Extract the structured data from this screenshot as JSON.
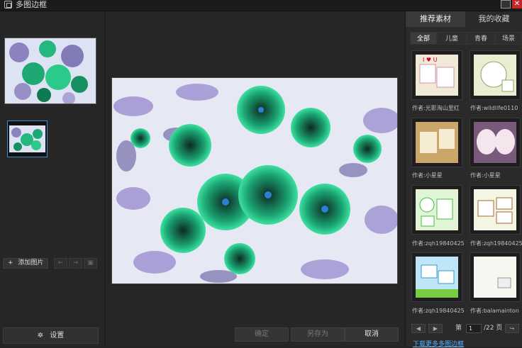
{
  "window": {
    "title": "多图边框",
    "close_glyph": "✕"
  },
  "left": {
    "add_photo_label": "添加图片",
    "add_icon": "+",
    "prev_glyph": "←",
    "next_glyph": "→",
    "delete_glyph": "▣",
    "settings_label": "设置",
    "settings_icon": "✲"
  },
  "center": {
    "confirm_label": "确定",
    "save_as_label": "另存为",
    "cancel_label": "取消"
  },
  "right": {
    "tabs": [
      {
        "label": "推荐素材",
        "active": true
      },
      {
        "label": "我的收藏",
        "active": false
      }
    ],
    "subtabs": [
      {
        "label": "全部",
        "active": true
      },
      {
        "label": "儿童",
        "active": false
      },
      {
        "label": "青春",
        "active": false
      },
      {
        "label": "场景",
        "active": false
      }
    ],
    "templates": [
      {
        "author": "作者:光影淘山里红"
      },
      {
        "author": "作者:wildlife0110"
      },
      {
        "author": "作者:小星星"
      },
      {
        "author": "作者:小星星"
      },
      {
        "author": "作者:zqh19840425"
      },
      {
        "author": "作者:zqh19840425"
      },
      {
        "author": "作者:zqh19840425"
      },
      {
        "author": "作者:balamainton"
      }
    ],
    "pager": {
      "prev": "◀",
      "next": "▶",
      "page_prefix": "第",
      "current_page": "1",
      "total": "/22 页",
      "go": "↪"
    },
    "download_link": "下载更多多图边框"
  }
}
